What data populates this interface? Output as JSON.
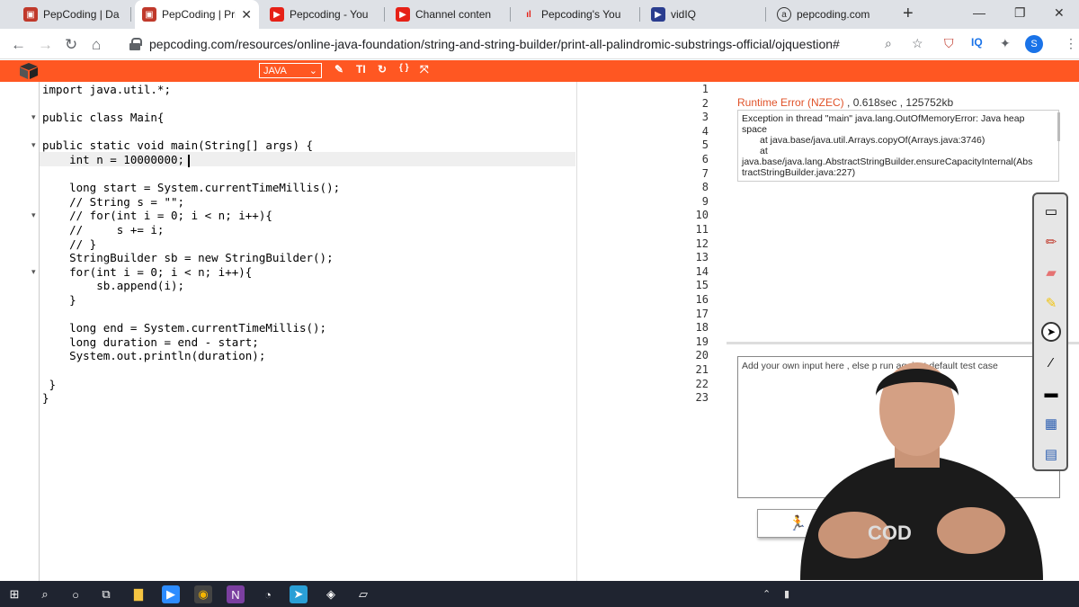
{
  "tabs": [
    {
      "title": "PepCoding | Da",
      "favicon": "pepcoding-favicon",
      "active": false
    },
    {
      "title": "PepCoding | Pri",
      "favicon": "pepcoding-favicon",
      "active": true
    },
    {
      "title": "Pepcoding - You",
      "favicon": "youtube-favicon",
      "active": false
    },
    {
      "title": "Channel conten",
      "favicon": "youtube-favicon",
      "active": false
    },
    {
      "title": "Pepcoding's You",
      "favicon": "analytics-favicon",
      "active": false
    },
    {
      "title": "vidIQ",
      "favicon": "vidiq-favicon",
      "active": false
    },
    {
      "title": "pepcoding.com",
      "favicon": "pepcoding-com-favicon",
      "active": false
    }
  ],
  "address": {
    "url": "pepcoding.com/resources/online-java-foundation/string-and-string-builder/print-all-palindromic-substrings-official/ojquestion#"
  },
  "profile_initial": "S",
  "toolbar": {
    "language": "JAVA"
  },
  "editor": {
    "lines": [
      "import java.util.*;",
      "",
      "public class Main{",
      "",
      "public static void main(String[] args) {",
      "    int n = 10000000;",
      "",
      "    long start = System.currentTimeMillis();",
      "    // String s = \"\";",
      "    // for(int i = 0; i < n; i++){",
      "    //     s += i;",
      "    // }",
      "    StringBuilder sb = new StringBuilder();",
      "    for(int i = 0; i < n; i++){",
      "        sb.append(i);",
      "    }",
      "",
      "    long end = System.currentTimeMillis();",
      "    long duration = end - start;",
      "    System.out.println(duration);",
      "",
      " }",
      "}"
    ],
    "line_numbers": [
      "1",
      "2",
      "3",
      "4",
      "5",
      "6",
      "7",
      "8",
      "9",
      "10",
      "11",
      "12",
      "13",
      "14",
      "15",
      "16",
      "17",
      "18",
      "19",
      "20",
      "21",
      "22",
      "23"
    ],
    "active_line": 6
  },
  "result": {
    "status": "Runtime Error (NZEC)",
    "time": ", 0.618sec",
    "memory": ", 125752kb",
    "output": [
      "Exception in thread \"main\" java.lang.OutOfMemoryError: Java heap",
      "space",
      "at java.base/java.util.Arrays.copyOf(Arrays.java:3746)",
      "at",
      "java.base/java.lang.AbstractStringBuilder.ensureCapacityInternal(Abs",
      "tractStringBuilder.java:227)"
    ]
  },
  "input": {
    "placeholder": "Add your own input here , else p run against default test case"
  },
  "colors": {
    "brand": "#ff5722",
    "error": "#e0532a"
  }
}
